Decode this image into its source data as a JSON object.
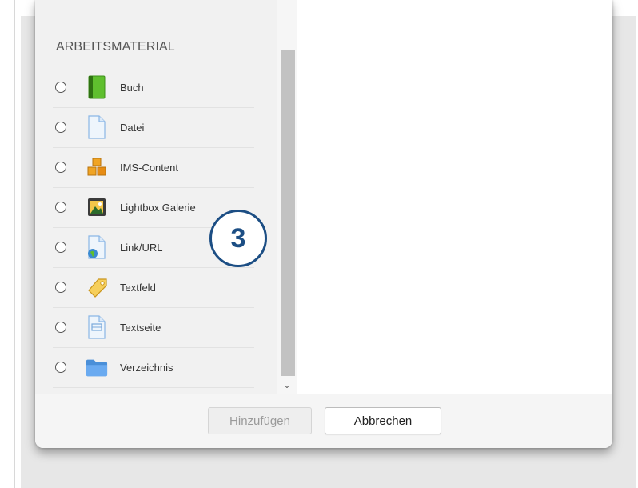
{
  "section": {
    "heading": "ARBEITSMATERIAL"
  },
  "options": [
    {
      "label": "Buch",
      "icon": "book-icon",
      "selected": false
    },
    {
      "label": "Datei",
      "icon": "file-icon",
      "selected": false
    },
    {
      "label": "IMS-Content",
      "icon": "ims-content-icon",
      "selected": false
    },
    {
      "label": "Lightbox Galerie",
      "icon": "gallery-icon",
      "selected": false
    },
    {
      "label": "Link/URL",
      "icon": "url-icon",
      "selected": false
    },
    {
      "label": "Textfeld",
      "icon": "label-icon",
      "selected": false
    },
    {
      "label": "Textseite",
      "icon": "page-icon",
      "selected": false
    },
    {
      "label": "Verzeichnis",
      "icon": "folder-icon",
      "selected": false
    }
  ],
  "annotation": {
    "step": "3",
    "color": "#1c4e84"
  },
  "footer": {
    "add_label": "Hinzufügen",
    "add_disabled": true,
    "cancel_label": "Abbrechen"
  },
  "colors": {
    "list_background": "#f1f1f1",
    "footer_background": "#f5f5f5"
  }
}
